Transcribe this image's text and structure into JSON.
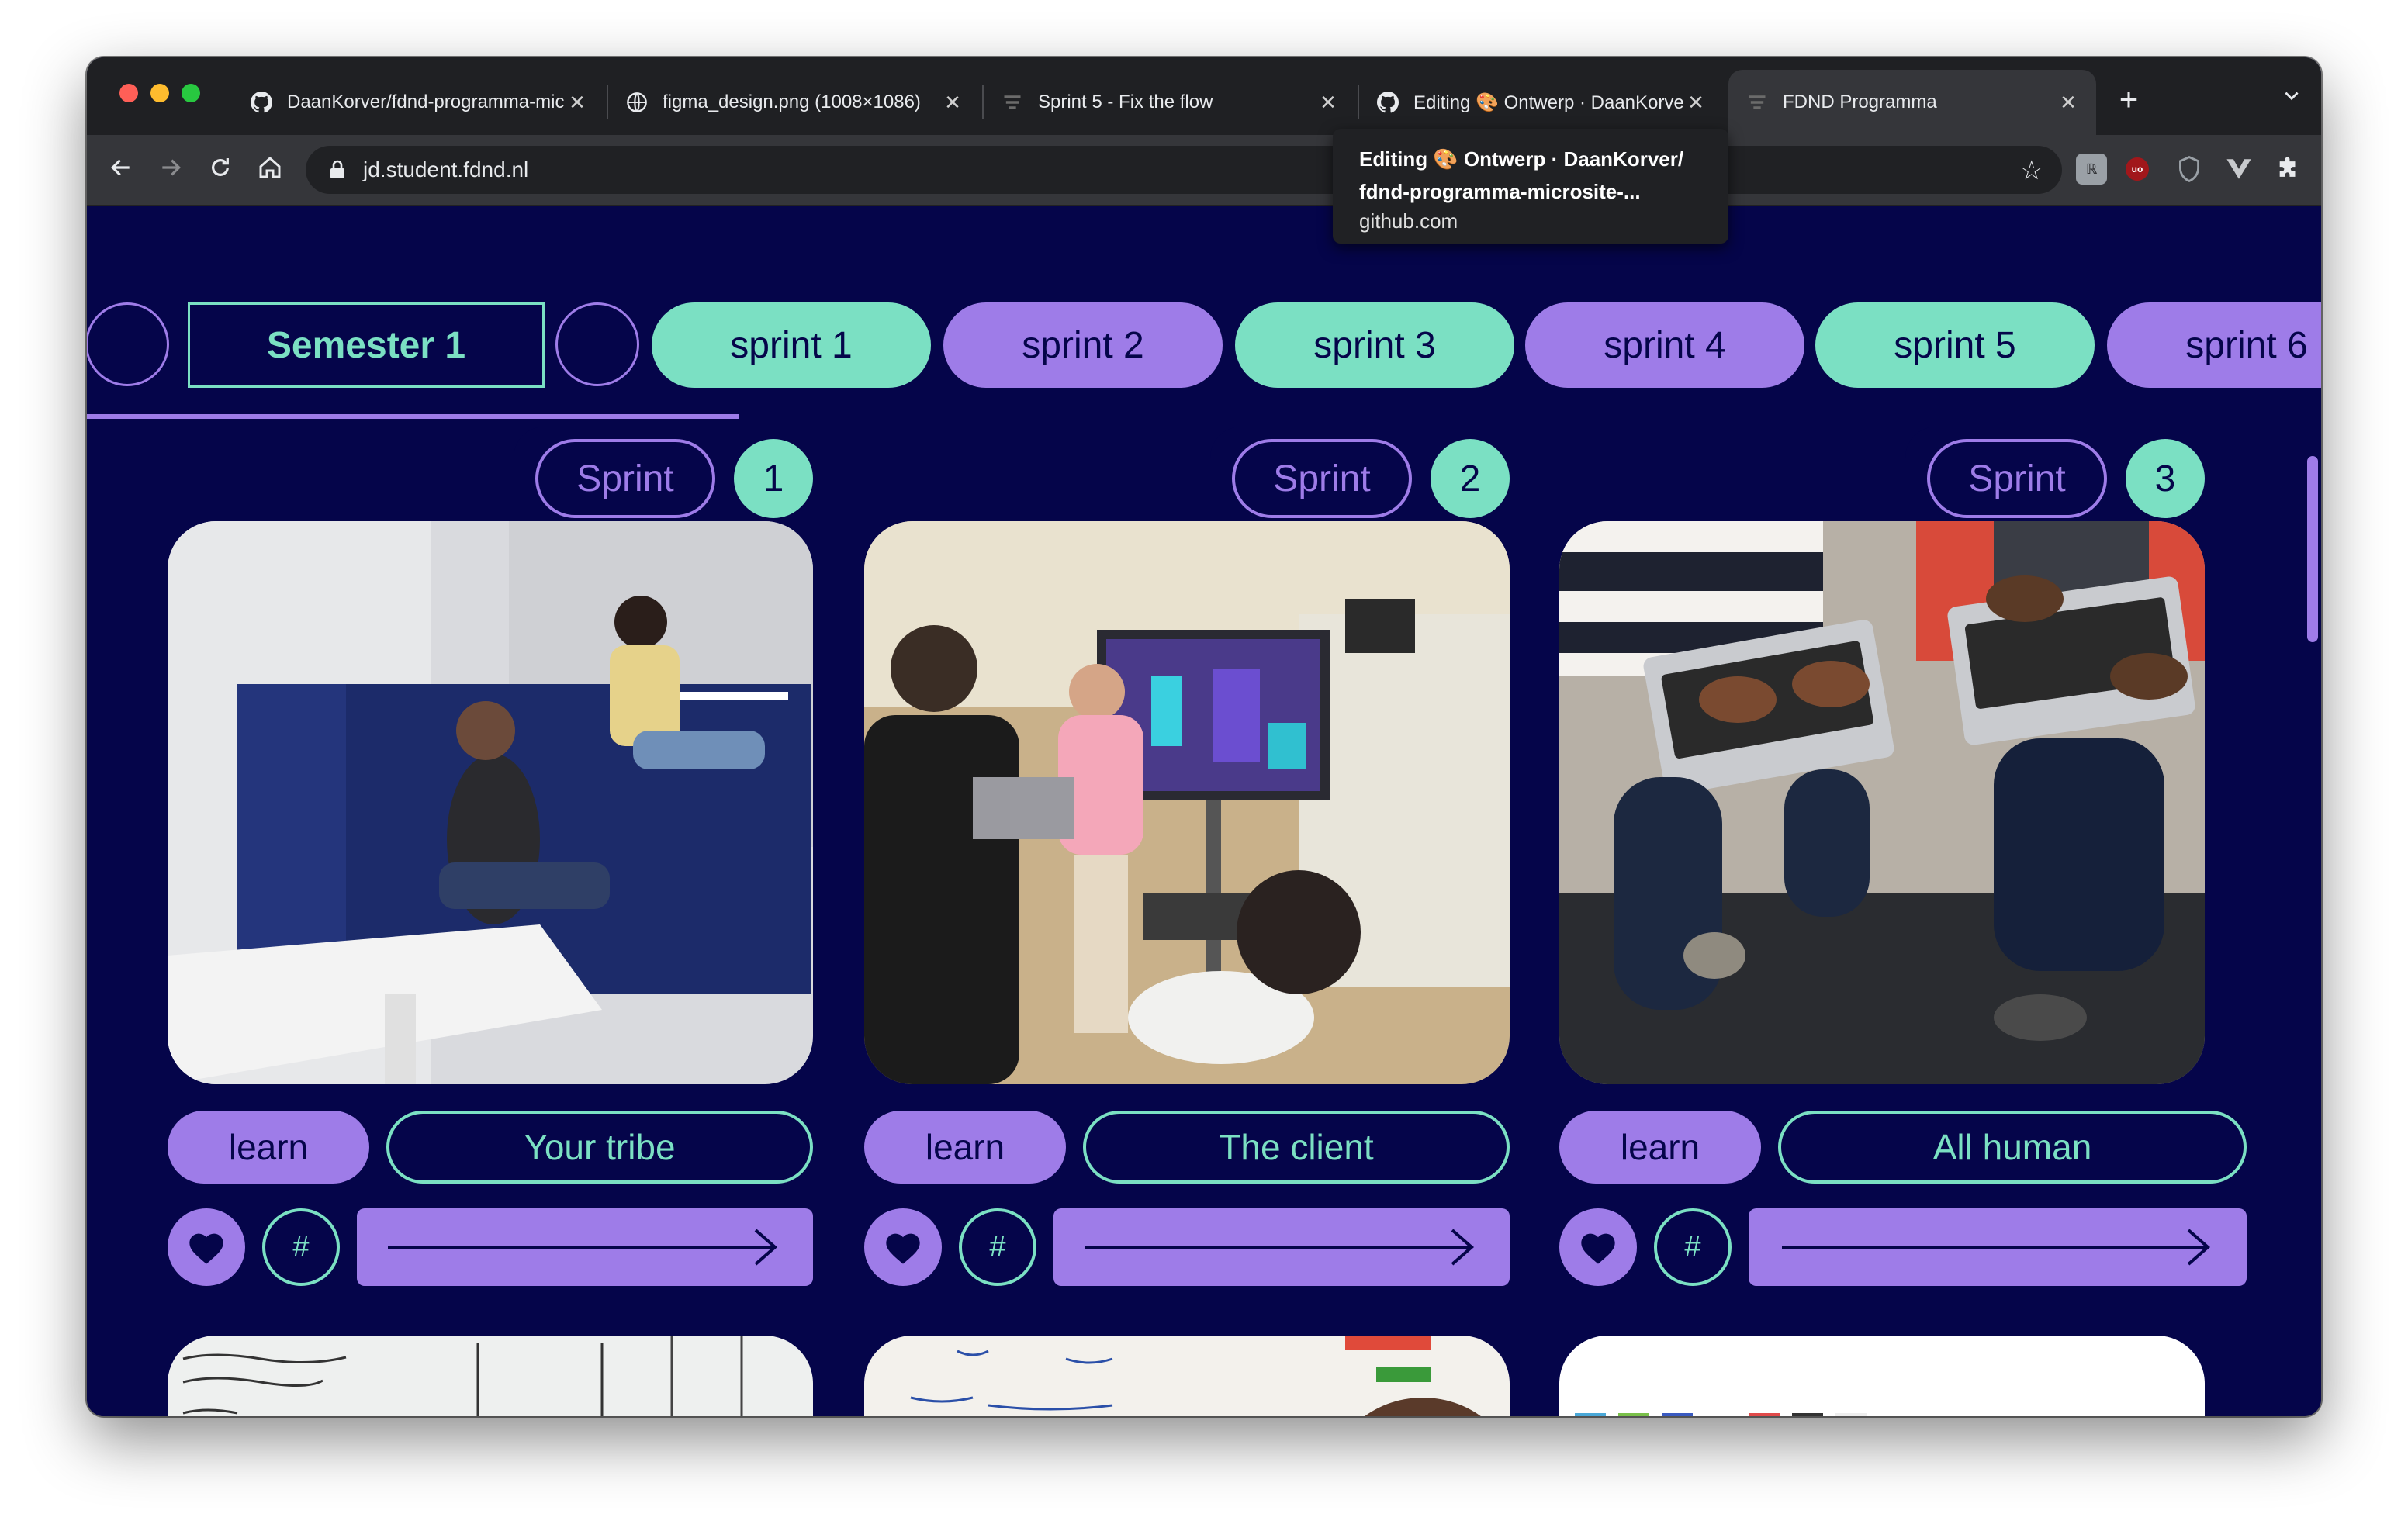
{
  "tabs": [
    {
      "title": "DaanKorver/fdnd-programma-microsite",
      "icon": "github-icon",
      "active": false
    },
    {
      "title": "figma_design.png (1008×1086)",
      "icon": "globe-icon",
      "active": false
    },
    {
      "title": "Sprint 5 - Fix the flow",
      "icon": "fdnd-icon",
      "active": false
    },
    {
      "title": "Editing 🎨 Ontwerp · DaanKorver/fdnd-programma-microsite",
      "icon": "github-icon",
      "active": false
    },
    {
      "title": "FDND Programma",
      "icon": "fdnd-icon",
      "active": true
    }
  ],
  "address_bar": {
    "url": "jd.student.fdnd.nl"
  },
  "tooltip": {
    "line1": "Editing 🎨 Ontwerp · DaanKorver/",
    "line2": "fdnd-programma-microsite-...",
    "line3": "github.com"
  },
  "nav": {
    "semester_label": "Semester 1",
    "sprints": [
      "sprint 1",
      "sprint 2",
      "sprint 3",
      "sprint 4",
      "sprint 5",
      "sprint 6"
    ]
  },
  "cards": [
    {
      "badge_label": "Sprint",
      "badge_number": "1",
      "category": "learn",
      "topic": "Your tribe"
    },
    {
      "badge_label": "Sprint",
      "badge_number": "2",
      "category": "learn",
      "topic": "The client"
    },
    {
      "badge_label": "Sprint",
      "badge_number": "3",
      "category": "learn",
      "topic": "All human"
    }
  ],
  "buttons": {
    "tag_symbol": "#"
  },
  "colors": {
    "background": "#05054a",
    "accent_green": "#7be0c3",
    "accent_purple": "#9e7ce8"
  }
}
